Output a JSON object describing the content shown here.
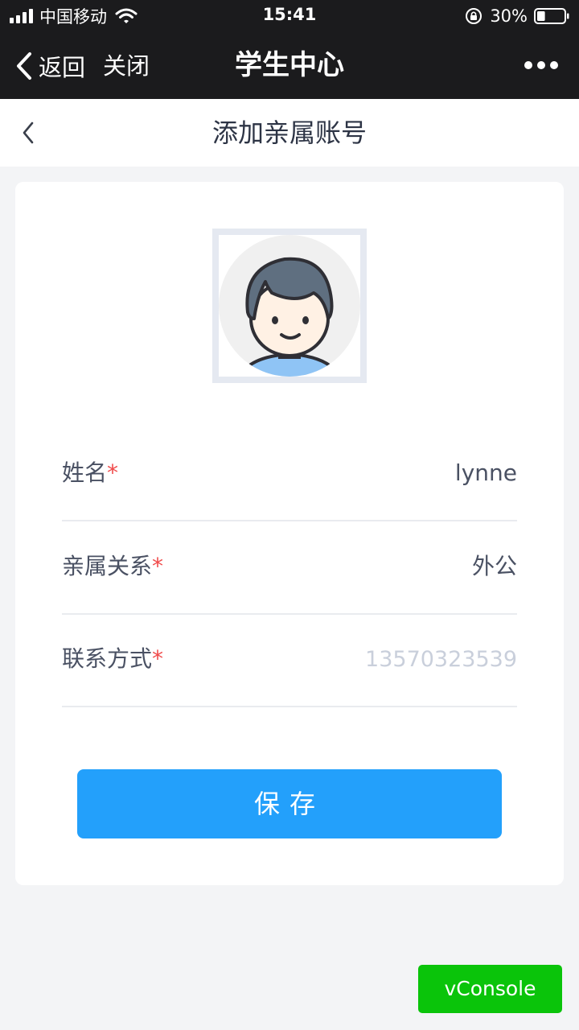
{
  "status_bar": {
    "carrier": "中国移动",
    "time": "15:41",
    "battery_percent": "30%",
    "battery_level": 0.3
  },
  "nav": {
    "back_label": "返回",
    "close_label": "关闭",
    "title": "学生中心"
  },
  "page": {
    "title": "添加亲属账号"
  },
  "form": {
    "name": {
      "label": "姓名",
      "required_mark": "*",
      "value": "lynne"
    },
    "relation": {
      "label": "亲属关系",
      "required_mark": "*",
      "value": "外公"
    },
    "contact": {
      "label": "联系方式",
      "required_mark": "*",
      "placeholder": "13570323539",
      "value": ""
    }
  },
  "save_button": {
    "label": "保存"
  },
  "vconsole": {
    "label": "vConsole"
  },
  "colors": {
    "bar_bg": "#1b1b1d",
    "accent": "#23a0fb",
    "required": "#f04b4b",
    "vconsole": "#0ac40a"
  }
}
